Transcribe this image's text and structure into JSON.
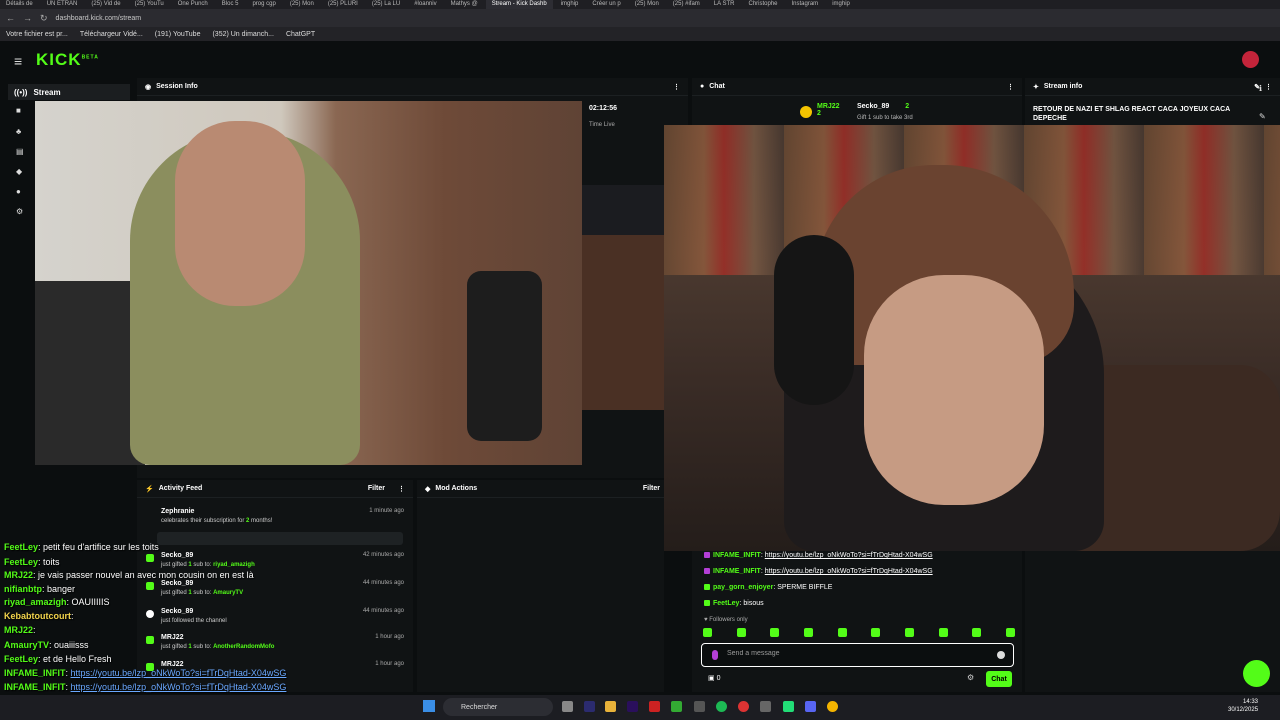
{
  "browser": {
    "tabs": [
      "Détails de",
      "UN ETRAN",
      "(25) Vid de",
      "(25) YouTu",
      "One Punch",
      "Bloc 5",
      "prog cgp",
      "(25) Mon",
      "(25) PLURI",
      "(25) La LU",
      "#loanniv",
      "Mathys @",
      "Stream - Kick Dashb",
      "imghip",
      "Créer un p",
      "(25) Mon",
      "(25) #ifam",
      "LA STR",
      "Christophe",
      "Instagram",
      "imghip"
    ],
    "active_tab": "Stream - Kick Dashb",
    "url": "dashboard.kick.com/stream",
    "bookmarks": [
      "Votre fichier est pr...",
      "Téléchargeur Vidé...",
      "(191) YouTube",
      "(352) Un dimanch...",
      "ChatGPT"
    ]
  },
  "kick": {
    "logo": "KICK",
    "logo_sup": "BETA",
    "sidebar_active": "Stream"
  },
  "panels": {
    "session_info": "Session Info",
    "time_value": "02:12:56",
    "time_label": "Time Live",
    "chat": "Chat",
    "stream_info": "Stream info",
    "stream_title": "RETOUR DE NAZI ET SHLAG REACT CACA JOYEUX CACA DEPECHE",
    "activity_feed": "Activity Feed",
    "filter": "Filter",
    "mod_actions": "Mod Actions",
    "mod_filter": "Filter"
  },
  "chat_top": {
    "user1": "MRJ22",
    "user1_count": "2",
    "user2": "Secko_89",
    "user2_count": "2",
    "gift_note": "Gift 1 sub to take 3rd"
  },
  "activity": [
    {
      "name": "Zephranie",
      "time": "1 minute ago",
      "desc_pre": "celebrates their subscription for ",
      "desc_hl": "2",
      "desc_post": " months!"
    },
    {
      "name": "Secko_89",
      "time": "42 minutes ago",
      "desc_pre": "just gifted ",
      "desc_hl": "1",
      "desc_post": " sub to: ",
      "target": "riyad_amazigh"
    },
    {
      "name": "Secko_89",
      "time": "44 minutes ago",
      "desc_pre": "just gifted ",
      "desc_hl": "1",
      "desc_post": " sub to: ",
      "target": "AmauryTV"
    },
    {
      "name": "Secko_89",
      "time": "44 minutes ago",
      "desc_pre": "just followed the channel",
      "desc_hl": "",
      "desc_post": ""
    },
    {
      "name": "MRJ22",
      "time": "1 hour ago",
      "desc_pre": "just gifted ",
      "desc_hl": "1",
      "desc_post": " sub to: ",
      "target": "AnotherRandomMofo"
    },
    {
      "name": "MRJ22",
      "time": "1 hour ago",
      "desc_pre": "",
      "desc_hl": "",
      "desc_post": ""
    }
  ],
  "overlay_chat": [
    {
      "user": "FeetLey",
      "text": " petit feu d'artifice sur les toits"
    },
    {
      "user": "FeetLey",
      "text": " toits"
    },
    {
      "user": "MRJ22",
      "text": " je vais passer nouvel an avec mon cousin on en est là"
    },
    {
      "user": "nifianbtp",
      "text": " banger"
    },
    {
      "user": "riyad_amazigh",
      "text": " OAUIIIIIS"
    },
    {
      "user": "Kebabtoutcourt",
      "text": ""
    },
    {
      "user": "MRJ22",
      "text": ""
    },
    {
      "user": "AmauryTV",
      "text": " ouaiiisss"
    },
    {
      "user": "FeetLey",
      "text": " et de Hello Fresh"
    },
    {
      "user": "INFAME_INFIT",
      "text": "",
      "link": "https://youtu.be/lzp_oNkWoTo?si=fTrDqHtad-X04wSG"
    },
    {
      "user": "INFAME_INFIT",
      "text": "",
      "link": "https://youtu.be/lzp_oNkWoTo?si=fTrDqHtad-X04wSG"
    },
    {
      "user": "pay_gorn_enjoyer",
      "text": " SPERME BIFFLE"
    },
    {
      "user": "FeetLey",
      "text": " bisous"
    }
  ],
  "chat_messages": [
    {
      "user": "INFAME_INFIT",
      "link": "https://youtu.be/lzp_oNkWoTo?si=fTrDqHtad-X04wSG",
      "text": ""
    },
    {
      "user": "INFAME_INFIT",
      "link": "https://youtu.be/lzp_oNkWoTo?si=fTrDqHtad-X04wSG",
      "text": ""
    },
    {
      "user": "pay_gorn_enjoyer",
      "link": "",
      "text": " SPERME BIFFLE"
    },
    {
      "user": "FeetLey",
      "link": "",
      "text": " bisous"
    }
  ],
  "chat_input": {
    "followers_only": "Followers only",
    "placeholder": "Send a message",
    "count": "0",
    "send_label": "Chat"
  },
  "taskbar": {
    "search_label": "Rechercher",
    "time": "14:33",
    "date": "30/12/2025"
  },
  "colors": {
    "accent": "#53fc18",
    "background": "#0b0e0f",
    "panel": "#101314"
  }
}
